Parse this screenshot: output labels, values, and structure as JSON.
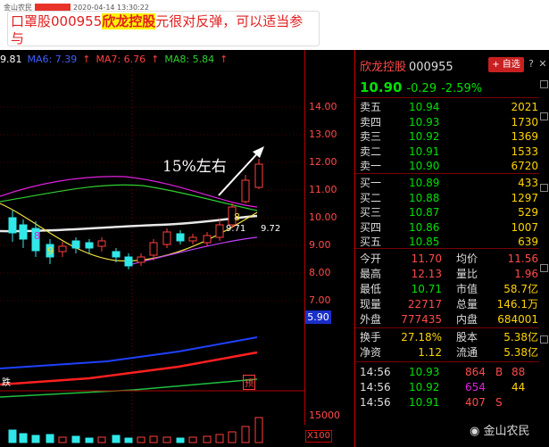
{
  "post": {
    "author": "金山农民",
    "timestamp": "2020-04-14 13:30:22",
    "text_prefix": "口罩股000955",
    "text_highlight": "欣龙控股",
    "text_suffix": "元很对反弹，可以适当参与"
  },
  "ma_legend": {
    "ma_prefix": "9.81",
    "ma6": "MA6: 7.39",
    "ma7": "MA7: 6.76",
    "ma8": "MA8: 5.84"
  },
  "price_axis": {
    "ticks": [
      "14.00",
      "13.00",
      "12.00",
      "11.00",
      "10.00",
      "9.00",
      "8.00",
      "7.00"
    ],
    "current_tag": "5.90",
    "volume_tick": "15000",
    "volume_unit": "X100"
  },
  "annotations": {
    "move_text": "15%左右",
    "label_971": "9.71",
    "label_972": "9.72",
    "digit_8_left": "8",
    "digit_9_left": "9",
    "digit_8_right": "8",
    "bottom_left": "跌",
    "bottom_right": "预"
  },
  "quote": {
    "name": "欣龙控股",
    "code": "000955",
    "add_button": "+ 自选",
    "price": "10.90",
    "change": "-0.29",
    "change_pct": "-2.59%",
    "asks": [
      {
        "label": "卖五",
        "price": "10.94",
        "qty": "2021"
      },
      {
        "label": "卖四",
        "price": "10.93",
        "qty": "1730"
      },
      {
        "label": "卖三",
        "price": "10.92",
        "qty": "1369"
      },
      {
        "label": "卖二",
        "price": "10.91",
        "qty": "1533"
      },
      {
        "label": "卖一",
        "price": "10.90",
        "qty": "6720"
      }
    ],
    "bids": [
      {
        "label": "买一",
        "price": "10.89",
        "qty": "433"
      },
      {
        "label": "买二",
        "price": "10.88",
        "qty": "1297"
      },
      {
        "label": "买三",
        "price": "10.87",
        "qty": "529"
      },
      {
        "label": "买四",
        "price": "10.86",
        "qty": "1007"
      },
      {
        "label": "买五",
        "price": "10.85",
        "qty": "639"
      }
    ],
    "stats": [
      {
        "l1": "今开",
        "v1": "11.70",
        "l2": "均价",
        "v2": "11.56"
      },
      {
        "l1": "最高",
        "v1": "12.13",
        "l2": "量比",
        "v2": "1.96"
      },
      {
        "l1": "最低",
        "v1": "10.71",
        "l2": "市值",
        "v2": "58.7亿"
      },
      {
        "l1": "现量",
        "v1": "22717",
        "l2": "总量",
        "v2": "146.1万"
      },
      {
        "l1": "外盘",
        "v1": "777435",
        "l2": "内盘",
        "v2": "684001"
      }
    ],
    "stats2": [
      {
        "l1": "换手",
        "v1": "27.18%",
        "l2": "股本",
        "v2": "5.38亿"
      },
      {
        "l1": "净资",
        "v1": "1.12",
        "l2": "流通",
        "v2": "5.38亿"
      }
    ],
    "trades": [
      {
        "time": "14:56",
        "price": "10.93",
        "vol": "864",
        "flag": "B",
        "n": "88"
      },
      {
        "time": "14:56",
        "price": "10.92",
        "vol": "654",
        "flag": "",
        "n": "44"
      },
      {
        "time": "14:56",
        "price": "10.91",
        "vol": "407",
        "flag": "S",
        "n": ""
      }
    ]
  },
  "watermark": "金山农民",
  "colors": {
    "up": "#ff4a4a",
    "down": "#00e000",
    "qty": "#ffd400",
    "axis": "#b00000"
  }
}
